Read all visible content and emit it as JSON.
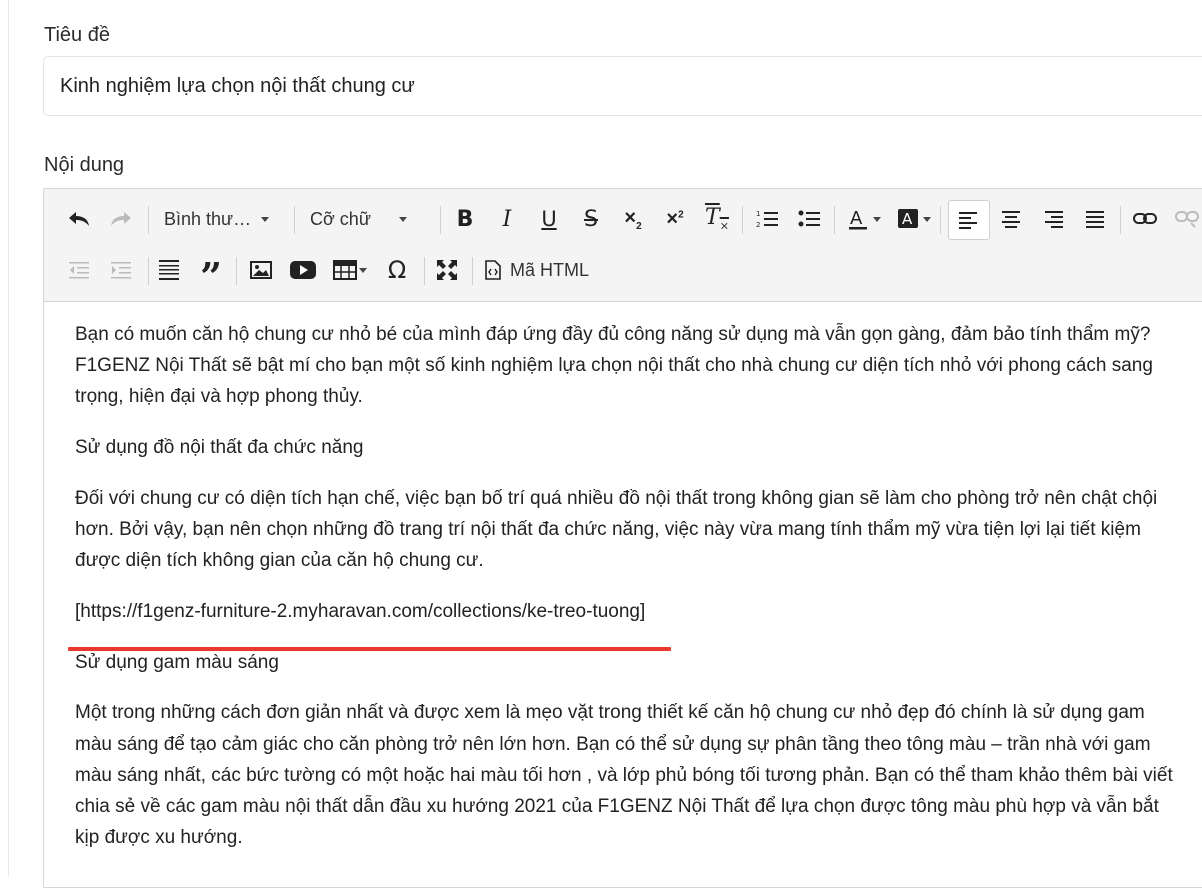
{
  "form": {
    "title_label": "Tiêu đề",
    "title_value": "Kinh nghiệm lựa chọn nội thất chung cư",
    "content_label": "Nội dung"
  },
  "toolbar": {
    "format_dropdown": "Bình thư…",
    "fontsize_dropdown": "Cỡ chữ",
    "html_button": "Mã HTML",
    "icons": [
      "undo-icon",
      "redo-icon",
      "bold-icon",
      "italic-icon",
      "underline-icon",
      "strikethrough-icon",
      "subscript-icon",
      "superscript-icon",
      "clear-format-icon",
      "ordered-list-icon",
      "unordered-list-icon",
      "text-color-icon",
      "background-color-icon",
      "align-left-icon",
      "align-center-icon",
      "align-right-icon",
      "align-justify-icon",
      "link-icon",
      "unlink-icon",
      "outdent-icon",
      "indent-icon",
      "line-height-icon",
      "blockquote-icon",
      "image-icon",
      "video-icon",
      "table-icon",
      "special-char-icon",
      "fullscreen-icon",
      "code-icon"
    ]
  },
  "content": {
    "paragraphs": [
      "Bạn có muốn căn hộ chung cư nhỏ bé của mình đáp ứng đầy đủ công năng sử dụng mà vẫn gọn gàng, đảm bảo tính thẩm mỹ? F1GENZ Nội Thất sẽ bật mí cho bạn một số kinh nghiệm lựa chọn nội thất cho nhà chung cư diện tích nhỏ với phong cách sang trọng, hiện đại và hợp phong thủy.",
      "Sử dụng đồ nội thất đa chức năng",
      "Đối với chung cư có diện tích hạn chế, việc bạn bố trí quá nhiều đồ nội thất trong không gian sẽ làm cho phòng trở nên chật chội hơn. Bởi vậy, bạn nên chọn những đồ trang trí nội thất đa chức năng, việc này vừa mang tính thẩm mỹ vừa tiện lợi lại tiết kiệm được diện tích không gian của căn hộ chung cư.",
      "[https://f1genz-furniture-2.myharavan.com/collections/ke-treo-tuong]",
      "Sử dụng gam màu sáng",
      "Một trong những cách đơn giản nhất và được xem là mẹo vặt trong thiết kế căn hộ chung cư nhỏ đẹp đó chính là sử dụng gam màu sáng để tạo cảm giác cho căn phòng trở nên lớn hơn. Bạn có thể sử dụng sự phân tầng theo tông màu – trần nhà với gam màu sáng nhất, các bức tường có một hoặc hai màu tối hơn , và lớp phủ bóng tối tương phản. Bạn có thể tham khảo thêm bài viết chia sẻ về các gam màu nội thất dẫn đầu xu hướng 2021 của F1GENZ Nội Thất để lựa chọn được tông màu phù hợp và vẫn bắt kịp được xu hướng."
    ]
  },
  "colors": {
    "annotation_underline": "#e8392a",
    "toolbar_bg": "#f4f4f4"
  }
}
